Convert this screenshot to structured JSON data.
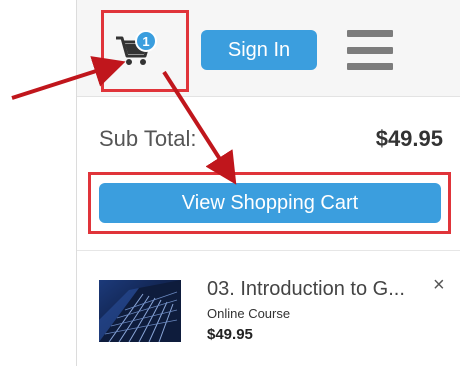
{
  "header": {
    "cart_icon": "shopping-cart-icon",
    "cart_count": "1",
    "signin_label": "Sign In",
    "menu_icon": "hamburger-menu-icon"
  },
  "cart": {
    "subtotal_label": "Sub Total:",
    "subtotal_value": "$49.95",
    "view_cart_label": "View Shopping Cart",
    "items": [
      {
        "title": "03. Introduction to G...",
        "type": "Online Course",
        "price": "$49.95",
        "remove_icon": "close-icon",
        "remove_label": "×"
      }
    ]
  },
  "colors": {
    "accent": "#3b9ede",
    "highlight": "#e0343a",
    "annotation_arrow": "#c0161c"
  }
}
